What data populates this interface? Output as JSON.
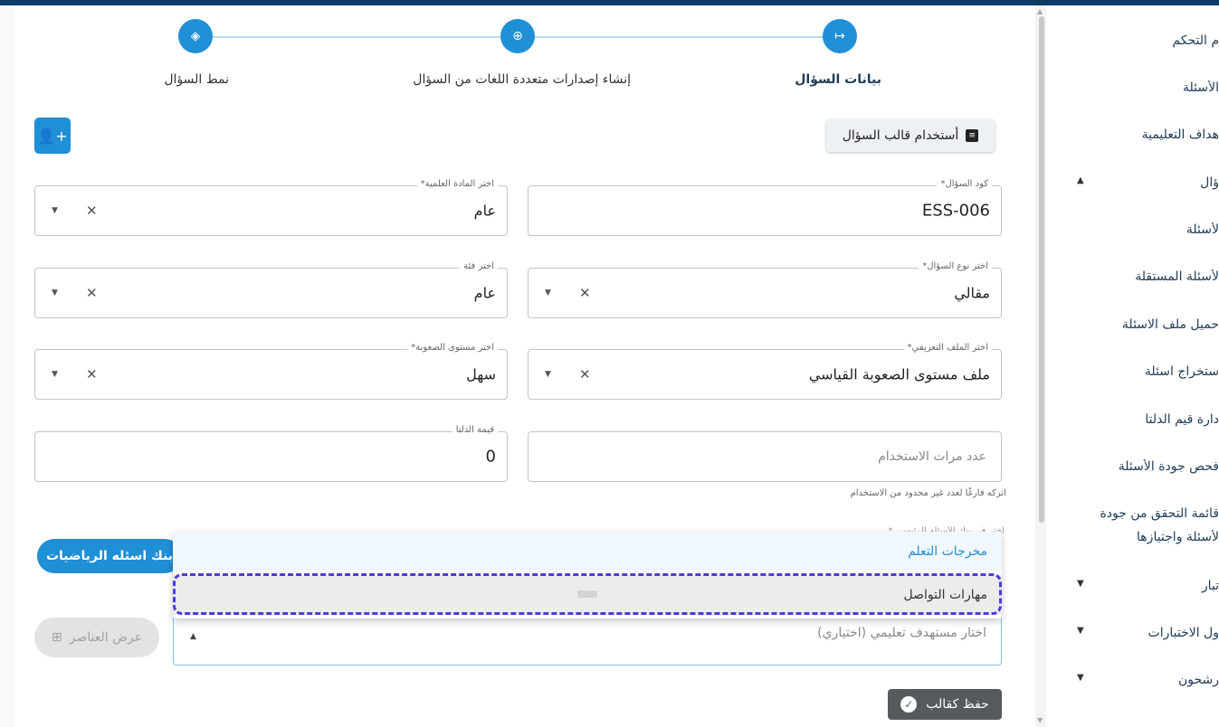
{
  "stepper": {
    "steps": [
      {
        "label": "بيانات السؤال",
        "icon": "arrow-right-to-bar-icon",
        "active": true
      },
      {
        "label": "إنشاء إصدارات متعددة اللغات من السؤال",
        "icon": "globe-icon",
        "active": false
      },
      {
        "label": "نمط السؤال",
        "icon": "layers-icon",
        "active": false
      }
    ]
  },
  "toolbar": {
    "template_button": "أستخدام قالب السؤال",
    "add_user_icon": "add-user-icon"
  },
  "form": {
    "code": {
      "label": "كود السؤال*",
      "value": "ESS-006"
    },
    "subject": {
      "label": "اختر المادة العلمية*",
      "value": "عام"
    },
    "type": {
      "label": "اختر نوع السؤال*",
      "value": "مقالي"
    },
    "category": {
      "label": "اختر فئة",
      "value": "عام"
    },
    "profile": {
      "label": "اختر الملف التعريفي*",
      "value": "ملف مستوى الصعوبة القياسي"
    },
    "difficulty": {
      "label": "اختر مستوى الصعوبة*",
      "value": "سهل"
    },
    "usage": {
      "placeholder": "عدد مرات الاستخدام",
      "helper": "اتركه فارغًا لعدد غير محدود من الاستخدام"
    },
    "delta": {
      "label": "قيمة الدلتا",
      "value": "0"
    },
    "bank_label": "اختر في بنك الأسئلة الرئيسي *",
    "bank_button": "بنك اسئله الرياضيات",
    "target": {
      "placeholder": "اختار مستهدف تعليمي (اختياري)"
    },
    "show_elements_button": "عرض العناصر",
    "save_button": "حفظ كقالب"
  },
  "dropdown": {
    "options": [
      "مخرجات التعلم",
      "مهارات التواصل"
    ],
    "highlighted_index": 1
  },
  "sidebar": {
    "items": [
      {
        "label": "م التحكم"
      },
      {
        "label": "الأسئلة"
      },
      {
        "label": "هداف التعليمية"
      },
      {
        "label": "ؤال",
        "caret": "▲"
      },
      {
        "label": "لأسئلة"
      },
      {
        "label": "لأسئلة المستقلة"
      },
      {
        "label": "حميل ملف الاسئلة"
      },
      {
        "label": "ستخراج اسئلة"
      },
      {
        "label": "دارة قيم الدلتا"
      },
      {
        "label": "فحص جودة الأسئلة"
      },
      {
        "label": "قائمة التحقق من جودة"
      },
      {
        "label": "لأسئلة واجتيازها"
      },
      {
        "label": "تبار",
        "caret": "▼"
      },
      {
        "label": "ول الاختبارات",
        "caret": "▼"
      },
      {
        "label": "رشحون",
        "caret": "▼"
      }
    ]
  },
  "colors": {
    "primary": "#1f8fd6",
    "topbar": "#0d3b66",
    "focus_ring": "#4a3cdb",
    "save_bg": "#555a5e"
  }
}
